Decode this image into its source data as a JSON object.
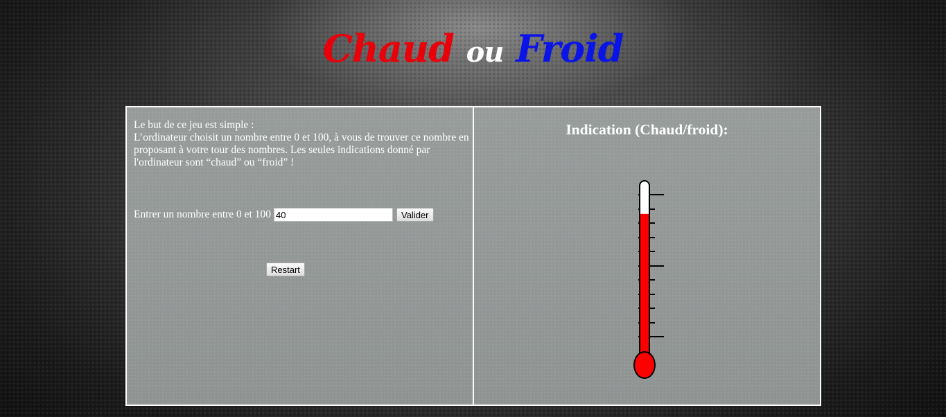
{
  "header": {
    "title_word1": "Chaud",
    "title_word2": "ou",
    "title_word3": "Froid"
  },
  "left_panel": {
    "rules_line1": "Le but de ce jeu est simple :",
    "rules_line2": "L’ordinateur choisit un nombre entre 0 et 100, à vous de trouver ce nombre en proposant à votre tour des nombres. Les seules indications donné par l'ordinateur sont “chaud” ou “froid” !",
    "input_label": "Entrer un nombre entre 0 et 100",
    "input_value": "40",
    "validate_label": "Valider",
    "restart_label": "Restart"
  },
  "right_panel": {
    "title": "Indication (Chaud/froid):",
    "thermometer_level": 0.82
  },
  "colors": {
    "hot": "#ff0000",
    "cold": "#0a14e6",
    "panel": "#969b9a",
    "border": "#ffffff"
  }
}
